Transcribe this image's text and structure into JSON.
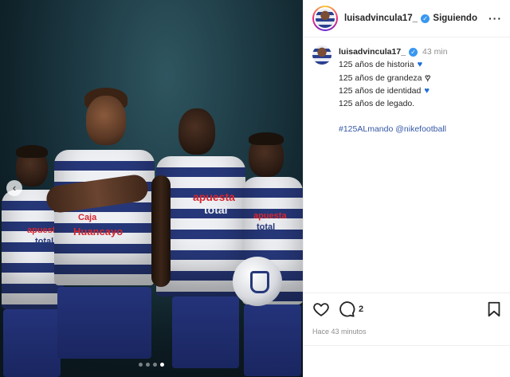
{
  "post": {
    "username": "luisadvincula17_",
    "follow_label": "Siguiendo",
    "more_label": "···",
    "time_short": "43 min",
    "caption_lines": [
      "125 años de historia",
      "125 años de grandeza",
      "125 años de identidad",
      "125 años de legado."
    ],
    "hearts": [
      "blue-heart",
      "white-heart",
      "blue-heart",
      ""
    ],
    "hashtag": "#125ALmando",
    "mention": "@nikefootball",
    "comment_count": "2",
    "time_long": "Hace 43 minutos"
  },
  "media": {
    "slide_count": 4,
    "active_slide": 4,
    "sponsor_line1": "apuesta",
    "sponsor_line2": "total",
    "sponsor_line3": "Caja",
    "sponsor_line4": "Huancayo"
  },
  "icons": {
    "verified": "verified-badge-icon",
    "like": "heart-icon",
    "comment": "comment-icon",
    "save": "bookmark-icon",
    "prev": "chevron-left-icon"
  },
  "colors": {
    "verified": "#3897f0",
    "heart_blue": "#1f6fd6",
    "link": "#3457a7",
    "jersey_blue": "#27387a"
  }
}
